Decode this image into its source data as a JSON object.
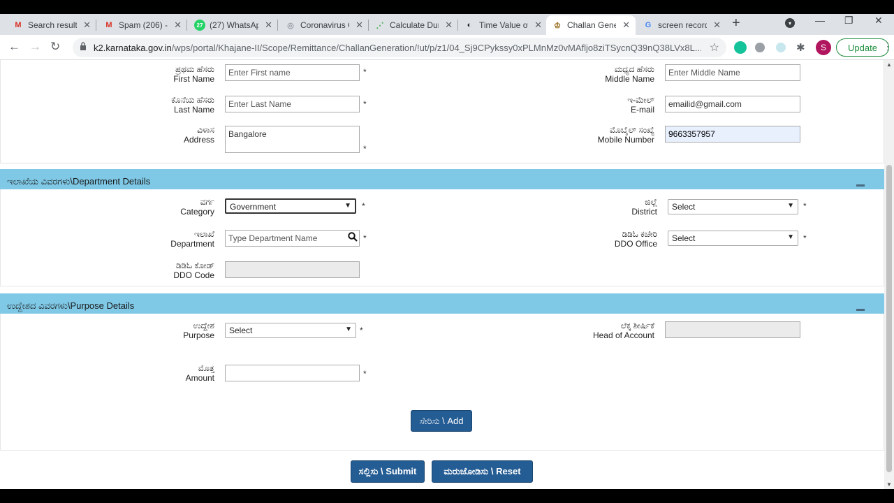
{
  "tabs": [
    {
      "icon": "M",
      "icon_name": "gmail-icon",
      "title": "Search results"
    },
    {
      "icon": "M",
      "icon_name": "gmail-icon",
      "title": "Spam (206) -"
    },
    {
      "icon": "27",
      "icon_name": "whatsapp-icon",
      "title": "(27) WhatsApp"
    },
    {
      "icon": "◎",
      "icon_name": "globe-icon",
      "title": "Coronavirus C"
    },
    {
      "icon": "⋰",
      "icon_name": "chart-icon",
      "title": "Calculate Dur"
    },
    {
      "icon": "◐",
      "icon_name": "tvm-icon",
      "title": "Time Value of"
    },
    {
      "icon": "♔",
      "icon_name": "karnataka-emblem-icon",
      "title": "Challan Gene"
    },
    {
      "icon": "G",
      "icon_name": "google-icon",
      "title": "screen record"
    }
  ],
  "browser": {
    "url_domain": "k2.karnataka.gov.in",
    "url_path": "/wps/portal/Khajane-II/Scope/Remittance/ChallanGeneration/!ut/p/z1/04_Sj9CPykssy0xPLMnMz0vMAfljo8ziTSycnQ39nQ38LVx8L...",
    "update_label": "Update",
    "avatar_letter": "S"
  },
  "personal": {
    "first_name_kn": "ಪ್ರಥಮ ಹೆಸರು",
    "first_name_en": "First Name",
    "first_name_ph": "Enter First name",
    "middle_name_kn": "ಮಧ್ಯದ ಹೆಸರು",
    "middle_name_en": "Middle Name",
    "middle_name_ph": "Enter Middle Name",
    "last_name_kn": "ಕೊನೆಯ ಹೆಸರು",
    "last_name_en": "Last Name",
    "last_name_ph": "Enter Last Name",
    "email_kn": "ಇ-ಮೇಲ್",
    "email_en": "E-mail",
    "email_value": "emailid@gmail.com",
    "address_kn": "ವಿಳಾಸ",
    "address_en": "Address",
    "address_value": "Bangalore",
    "mobile_kn": "ಮೊಬೈಲ್ ಸಂಖ್ಯೆ",
    "mobile_en": "Mobile Number",
    "mobile_value": "9663357957"
  },
  "department": {
    "header": "ಇಲಾಖೆಯ ವಿವರಗಳು\\Department Details",
    "category_kn": "ವರ್ಗ",
    "category_en": "Category",
    "category_value": "Government",
    "district_kn": "ಜಿಲ್ಲೆ",
    "district_en": "District",
    "district_value": "Select",
    "dept_kn": "ಇಲಾಖೆ",
    "dept_en": "Department",
    "dept_ph": "Type Department Name",
    "ddo_office_kn": "ಡಿಡಿಓ ಕಚೇರಿ",
    "ddo_office_en": "DDO Office",
    "ddo_office_value": "Select",
    "ddo_code_kn": "ಡಿಡಿಓ ಕೋಡ್",
    "ddo_code_en": "DDO Code"
  },
  "purpose": {
    "header": "ಉದ್ದೇಶದ ವಿವರಗಳು\\Purpose Details",
    "purpose_kn": "ಉದ್ದೇಶ",
    "purpose_en": "Purpose",
    "purpose_value": "Select",
    "hoa_kn": "ಲೆಕ್ಕ ಶೀರ್ಷಿಕೆ",
    "hoa_en": "Head of Account",
    "amount_kn": "ಮೊತ್ತ",
    "amount_en": "Amount",
    "add_label": "ಸೇರಿಸು \\ Add"
  },
  "actions": {
    "submit_label": "ಸಲ್ಲಿಸು \\ Submit",
    "reset_label": "ಮರುಜೋಡಿಸು \\ Reset"
  },
  "required_mark": "*"
}
